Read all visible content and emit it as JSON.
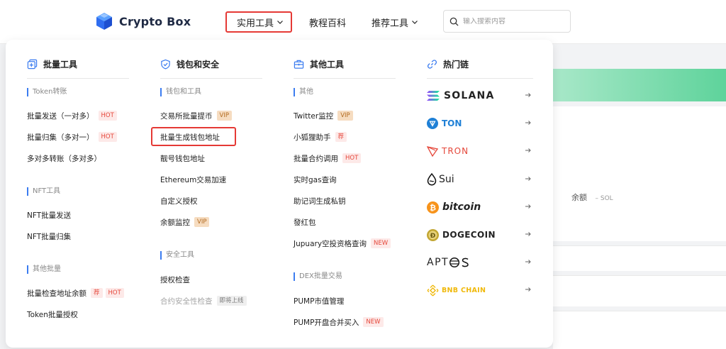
{
  "header": {
    "logo_text": "Crypto Box",
    "nav": [
      {
        "label": "实用工具"
      },
      {
        "label": "教程百科"
      },
      {
        "label": "推荐工具"
      }
    ],
    "search_placeholder": "输入搜索内容"
  },
  "background": {
    "balance_label": "余额",
    "balance_value": "– SOL"
  },
  "dropdown": {
    "columns": [
      {
        "title": "批量工具",
        "sections": [
          {
            "title": "Token转账",
            "items": [
              {
                "label": "批量发送（一对多）",
                "tags": [
                  "HOT"
                ]
              },
              {
                "label": "批量归集（多对一）",
                "tags": [
                  "HOT"
                ]
              },
              {
                "label": "多对多转账（多对多）",
                "tags": []
              }
            ]
          },
          {
            "title": "NFT工具",
            "items": [
              {
                "label": "NFT批量发送",
                "tags": []
              },
              {
                "label": "NFT批量归集",
                "tags": []
              }
            ]
          },
          {
            "title": "其他批量",
            "items": [
              {
                "label": "批量检查地址余额",
                "tags": [
                  "荐",
                  "HOT"
                ]
              },
              {
                "label": "Token批量授权",
                "tags": []
              }
            ]
          }
        ]
      },
      {
        "title": "钱包和安全",
        "sections": [
          {
            "title": "钱包和工具",
            "items": [
              {
                "label": "交易所批量提币",
                "tags": [
                  "VIP"
                ]
              },
              {
                "label": "批量生成钱包地址",
                "tags": []
              },
              {
                "label": "靓号钱包地址",
                "tags": []
              },
              {
                "label": "Ethereum交易加速",
                "tags": []
              },
              {
                "label": "自定义授权",
                "tags": []
              },
              {
                "label": "余额监控",
                "tags": [
                  "VIP"
                ]
              }
            ]
          },
          {
            "title": "安全工具",
            "items": [
              {
                "label": "授权检查",
                "tags": []
              },
              {
                "label": "合约安全性检查",
                "tags": [
                  "即将上线"
                ]
              }
            ]
          }
        ]
      },
      {
        "title": "其他工具",
        "sections": [
          {
            "title": "其他",
            "items": [
              {
                "label": "Twitter监控",
                "tags": [
                  "VIP"
                ]
              },
              {
                "label": "小狐狸助手",
                "tags": [
                  "荐"
                ]
              },
              {
                "label": "批量合约调用",
                "tags": [
                  "HOT"
                ]
              },
              {
                "label": "实时gas查询",
                "tags": []
              },
              {
                "label": "助记词生成私钥",
                "tags": []
              },
              {
                "label": "發红包",
                "tags": []
              },
              {
                "label": "Jupuary空投资格查询",
                "tags": [
                  "NEW"
                ]
              }
            ]
          },
          {
            "title": "DEX批量交易",
            "items": [
              {
                "label": "PUMP市值管理",
                "tags": []
              },
              {
                "label": "PUMP开盘合并买入",
                "tags": [
                  "NEW"
                ]
              }
            ]
          }
        ]
      },
      {
        "title": "热门链",
        "chains": [
          {
            "name": "SOLANA",
            "color": "#111111"
          },
          {
            "name": "TON",
            "color": "#1f80d6"
          },
          {
            "name": "TRON",
            "color": "#e5473a"
          },
          {
            "name": "Sui",
            "color": "#111111"
          },
          {
            "name": "bitcoin",
            "color": "#222222"
          },
          {
            "name": "DOGECOIN",
            "color": "#111111"
          },
          {
            "name": "APT",
            "color": "#111111"
          },
          {
            "name": "BNB CHAIN",
            "color": "#f0b90b"
          }
        ]
      }
    ]
  }
}
